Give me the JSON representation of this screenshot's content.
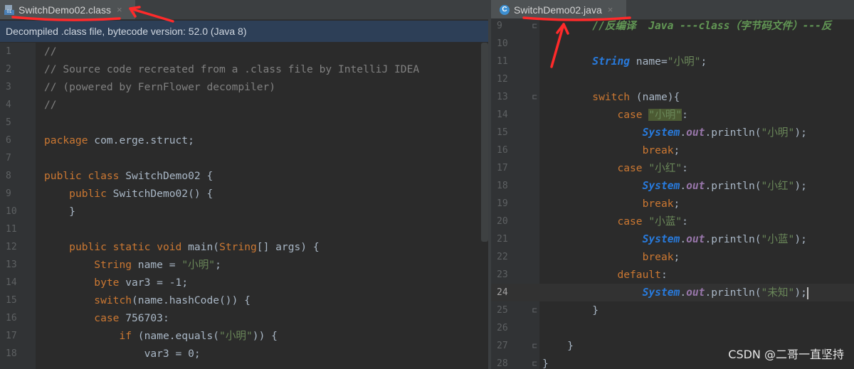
{
  "left_tab": {
    "label": "SwitchDemo02.class",
    "icon": "class-file-icon",
    "close": "×"
  },
  "right_tab": {
    "label": "SwitchDemo02.java",
    "icon": "java-class-icon",
    "close": "×"
  },
  "banner": "Decompiled .class file, bytecode version: 52.0 (Java 8)",
  "left_lines": [
    {
      "n": "1",
      "t": "//"
    },
    {
      "n": "2",
      "t": "// Source code recreated from a .class file by IntelliJ IDEA"
    },
    {
      "n": "3",
      "t": "// (powered by FernFlower decompiler)"
    },
    {
      "n": "4",
      "t": "//"
    },
    {
      "n": "5",
      "t": ""
    },
    {
      "n": "6",
      "t": "package com.erge.struct;"
    },
    {
      "n": "7",
      "t": ""
    },
    {
      "n": "8",
      "t": "public class SwitchDemo02 {"
    },
    {
      "n": "9",
      "t": "    public SwitchDemo02() {"
    },
    {
      "n": "10",
      "t": "    }"
    },
    {
      "n": "11",
      "t": ""
    },
    {
      "n": "12",
      "t": "    public static void main(String[] args) {"
    },
    {
      "n": "13",
      "t": "        String name = \"小明\";"
    },
    {
      "n": "14",
      "t": "        byte var3 = -1;"
    },
    {
      "n": "15",
      "t": "        switch(name.hashCode()) {"
    },
    {
      "n": "16",
      "t": "        case 756703:"
    },
    {
      "n": "17",
      "t": "            if (name.equals(\"小明\")) {"
    },
    {
      "n": "18",
      "t": "                var3 = 0;"
    }
  ],
  "right_lines": [
    {
      "n": "9",
      "t": "        //反编译  Java ---class（字节码文件）---反"
    },
    {
      "n": "10",
      "t": ""
    },
    {
      "n": "11",
      "t": "        String name=\"小明\";"
    },
    {
      "n": "12",
      "t": ""
    },
    {
      "n": "13",
      "t": "        switch (name){"
    },
    {
      "n": "14",
      "t": "            case \"小明\":"
    },
    {
      "n": "15",
      "t": "                System.out.println(\"小明\");"
    },
    {
      "n": "16",
      "t": "                break;"
    },
    {
      "n": "17",
      "t": "            case \"小红\":"
    },
    {
      "n": "18",
      "t": "                System.out.println(\"小红\");"
    },
    {
      "n": "19",
      "t": "                break;"
    },
    {
      "n": "20",
      "t": "            case \"小蓝\":"
    },
    {
      "n": "21",
      "t": "                System.out.println(\"小蓝\");"
    },
    {
      "n": "22",
      "t": "                break;"
    },
    {
      "n": "23",
      "t": "            default:"
    },
    {
      "n": "24",
      "t": "                System.out.println(\"未知\");"
    },
    {
      "n": "25",
      "t": "        }"
    },
    {
      "n": "26",
      "t": ""
    },
    {
      "n": "27",
      "t": "    }"
    },
    {
      "n": "28",
      "t": "}"
    }
  ],
  "watermark": "CSDN @二哥一直坚持",
  "colors": {
    "keyword": "#cc7832",
    "string": "#6a8759",
    "comment": "#808080",
    "annotation_red": "#ff2a2a"
  }
}
